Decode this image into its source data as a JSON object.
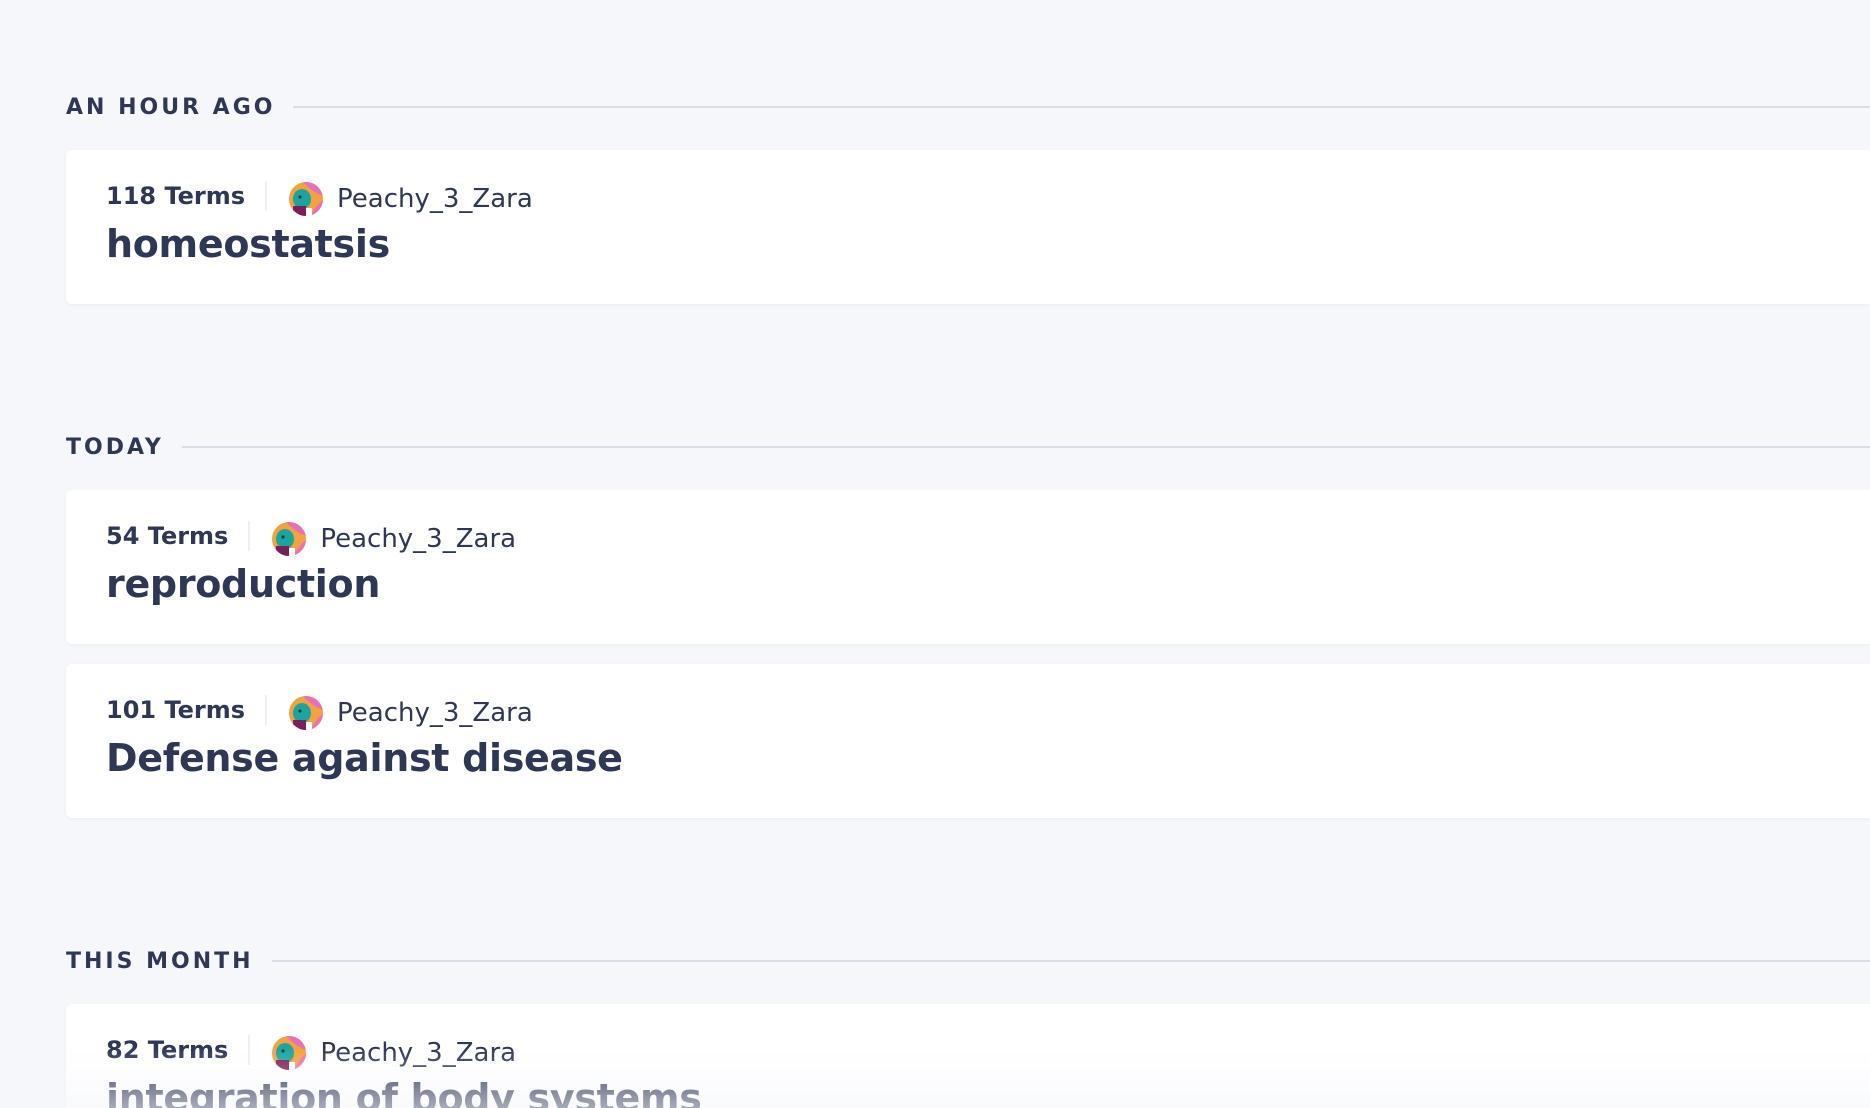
{
  "groups": [
    {
      "label": "AN HOUR AGO",
      "sets": [
        {
          "terms": "118 Terms",
          "author": "Peachy_3_Zara",
          "title": "homeostatsis"
        }
      ]
    },
    {
      "label": "TODAY",
      "sets": [
        {
          "terms": "54 Terms",
          "author": "Peachy_3_Zara",
          "title": "reproduction"
        },
        {
          "terms": "101 Terms",
          "author": "Peachy_3_Zara",
          "title": "Defense against disease"
        }
      ]
    },
    {
      "label": "THIS MONTH",
      "sets": [
        {
          "terms": "82 Terms",
          "author": "Peachy_3_Zara",
          "title": "integration of body systems"
        }
      ]
    }
  ],
  "avatar": {
    "icon": "user-avatar-icon",
    "colors": [
      "#f4a23b",
      "#e86fb8",
      "#1aa6a0",
      "#7b1e5a"
    ]
  },
  "colors": {
    "background": "#f6f7fb",
    "card": "#ffffff",
    "text": "#2e3856",
    "rule": "#d9dde8"
  }
}
